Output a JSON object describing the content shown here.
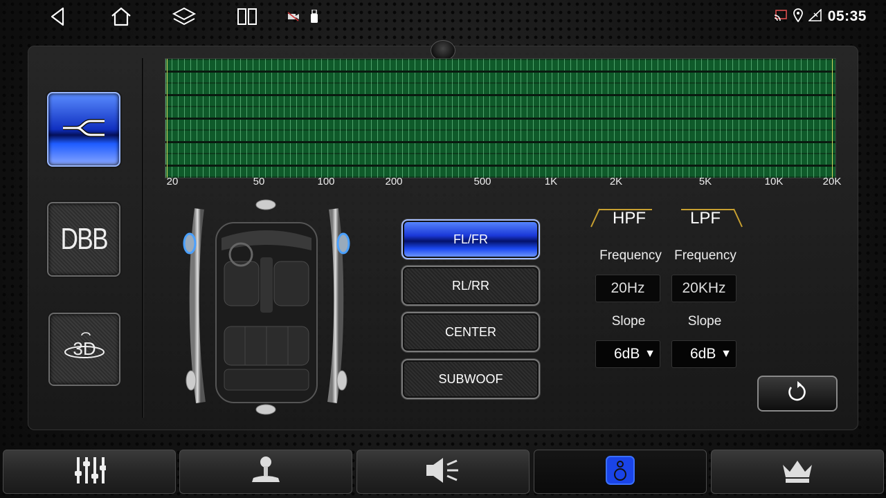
{
  "status_bar": {
    "nav_icons": [
      "back-icon",
      "home-icon",
      "layers-icon",
      "split-screen-icon"
    ],
    "notification_icons": [
      "camera-off-icon",
      "usb-icon"
    ],
    "status_icons": [
      "cast-icon",
      "location-icon",
      "signal-icon"
    ],
    "time": "05:35"
  },
  "side_buttons": [
    {
      "name": "crossover",
      "icon": "crossover-icon",
      "active": true
    },
    {
      "name": "dbb",
      "label": "DBB",
      "active": false
    },
    {
      "name": "3d",
      "icon": "3d-sound-icon",
      "active": false
    }
  ],
  "graph": {
    "freq_labels": [
      "20",
      "50",
      "100",
      "200",
      "500",
      "1K",
      "2K",
      "5K",
      "10K",
      "20K"
    ],
    "bg_color": "#0f5a2a"
  },
  "channels": [
    {
      "label": "FL/FR",
      "active": true
    },
    {
      "label": "RL/RR",
      "active": false
    },
    {
      "label": "CENTER",
      "active": false
    },
    {
      "label": "SUBWOOF",
      "active": false
    }
  ],
  "filters": {
    "hpf": {
      "title": "HPF",
      "freq_label": "Frequency",
      "freq_value": "20Hz",
      "slope_label": "Slope",
      "slope_value": "6dB"
    },
    "lpf": {
      "title": "LPF",
      "freq_label": "Frequency",
      "freq_value": "20KHz",
      "slope_label": "Slope",
      "slope_value": "6dB"
    }
  },
  "bottom_tabs": [
    {
      "icon": "equalizer-sliders-icon",
      "active": false
    },
    {
      "icon": "joystick-balance-icon",
      "active": false
    },
    {
      "icon": "speaker-volume-icon",
      "active": false
    },
    {
      "icon": "speaker-setting-icon",
      "active": true
    },
    {
      "icon": "crown-icon",
      "active": false
    }
  ],
  "colors": {
    "accent_blue": "#1a44e8",
    "tab_gold": "#c8a030"
  }
}
